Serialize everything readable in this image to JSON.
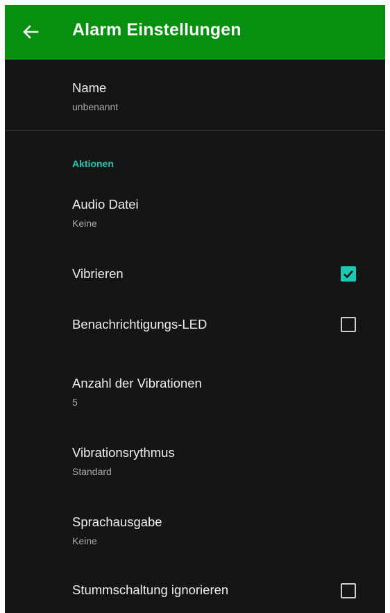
{
  "appbar": {
    "title": "Alarm Einstellungen",
    "back_icon": "arrow-left-icon",
    "background": "#07900f"
  },
  "name_pref": {
    "title": "Name",
    "summary": "unbenannt"
  },
  "section": {
    "label": "Aktionen",
    "accent": "#1ec8b4"
  },
  "prefs": {
    "audio": {
      "title": "Audio Datei",
      "summary": "Keine"
    },
    "vibrate": {
      "title": "Vibrieren",
      "checked": true
    },
    "led": {
      "title": "Benachrichtigungs-LED",
      "checked": false
    },
    "vib_count": {
      "title": "Anzahl der Vibrationen",
      "summary": "5"
    },
    "vib_pattern": {
      "title": "Vibrationsrythmus",
      "summary": "Standard"
    },
    "speech": {
      "title": "Sprachausgabe",
      "summary": "Keine"
    },
    "ignore_mute": {
      "title": "Stummschaltung ignorieren",
      "checked": false
    }
  },
  "colors": {
    "background": "#151515",
    "checkbox_on": "#1cc9b3"
  }
}
